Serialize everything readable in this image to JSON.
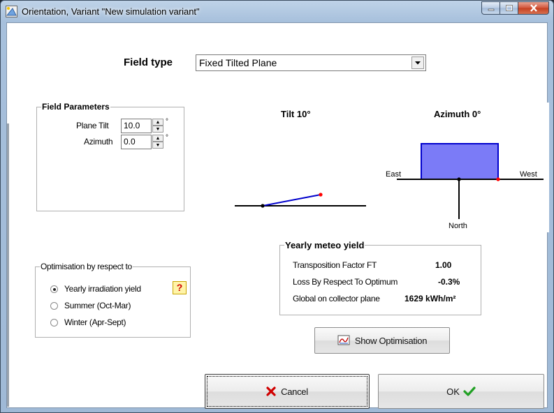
{
  "window": {
    "title": "Orientation, Variant \"New simulation variant\""
  },
  "field_type": {
    "label": "Field type",
    "value": "Fixed Tilted Plane"
  },
  "field_parameters": {
    "title": "Field Parameters",
    "plane_tilt_label": "Plane Tilt",
    "plane_tilt_value": "10.0",
    "azimuth_label": "Azimuth",
    "azimuth_value": "0.0",
    "unit": "°"
  },
  "diagram": {
    "tilt_label": "Tilt 10°",
    "azimuth_label": "Azimuth 0°",
    "east": "East",
    "west": "West",
    "north": "North",
    "colors": {
      "fill": "#7b7bf7",
      "stroke": "#0000cc",
      "marker": "#ff0000"
    }
  },
  "optimisation": {
    "title": "Optimisation by respect to",
    "options": [
      {
        "label": "Yearly irradiation yield",
        "checked": true
      },
      {
        "label": "Summer (Oct-Mar)",
        "checked": false
      },
      {
        "label": "Winter (Apr-Sept)",
        "checked": false
      }
    ],
    "help": "?"
  },
  "yearly_meteo": {
    "title": "Yearly meteo yield",
    "rows": [
      {
        "label": "Transposition Factor FT",
        "value": "1.00"
      },
      {
        "label": "Loss By Respect To Optimum",
        "value": "-0.3%"
      },
      {
        "label": "Global on collector plane",
        "value": "1629 kWh/m²"
      }
    ]
  },
  "buttons": {
    "show_optimisation": "Show Optimisation",
    "cancel": "Cancel",
    "ok": "OK"
  }
}
